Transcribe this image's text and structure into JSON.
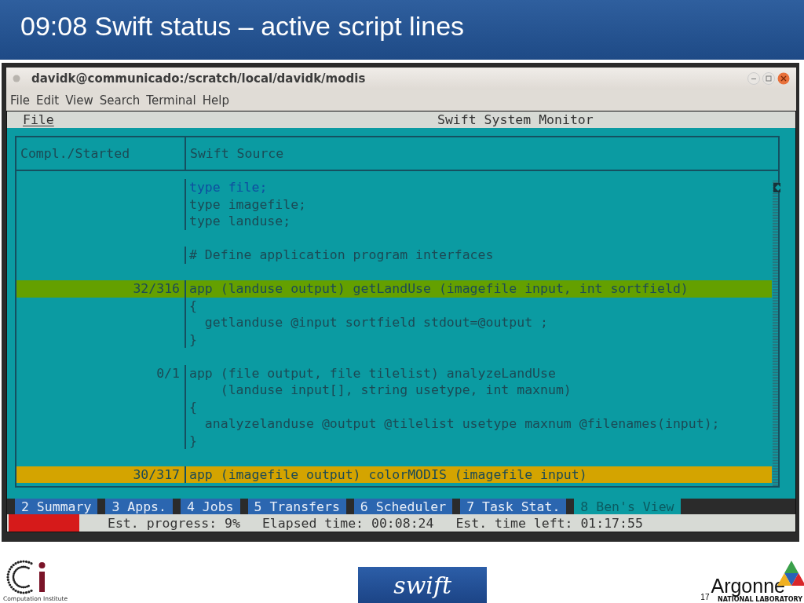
{
  "slide": {
    "title": "09:08 Swift status – active script lines",
    "page_number": "17"
  },
  "window": {
    "title": "davidk@communicado:/scratch/local/davidk/modis",
    "menu": [
      "File",
      "Edit",
      "View",
      "Search",
      "Terminal",
      "Help"
    ]
  },
  "monitor": {
    "menu_item": "File",
    "title": "Swift System Monitor",
    "columns": [
      "Compl./Started",
      "Swift Source"
    ],
    "lines": [
      {
        "kind": "muted",
        "text": "type file;"
      },
      {
        "kind": "code",
        "text": "type imagefile;"
      },
      {
        "kind": "code",
        "text": "type landuse;"
      },
      {
        "kind": "blank"
      },
      {
        "kind": "code",
        "text": "# Define application program interfaces"
      },
      {
        "kind": "blank"
      },
      {
        "kind": "code",
        "count": "32/316",
        "text": "app (landuse output) getLandUse (imagefile input, int sortfield)",
        "color": "#64a000"
      },
      {
        "kind": "code",
        "text": "{"
      },
      {
        "kind": "code",
        "text": "  getlanduse @input sortfield stdout=@output ;"
      },
      {
        "kind": "code",
        "text": "}"
      },
      {
        "kind": "blank"
      },
      {
        "kind": "code",
        "count": "0/1",
        "text": "app (file output, file tilelist) analyzeLandUse"
      },
      {
        "kind": "code",
        "text": "    (landuse input[], string usetype, int maxnum)"
      },
      {
        "kind": "code",
        "text": "{"
      },
      {
        "kind": "code",
        "text": "  analyzelanduse @output @tilelist usetype maxnum @filenames(input);"
      },
      {
        "kind": "code",
        "text": "}"
      },
      {
        "kind": "blank"
      },
      {
        "kind": "code",
        "count": "30/317",
        "text": "app (imagefile output) colorMODIS (imagefile input)",
        "color": "#d4a400"
      }
    ],
    "tabs": [
      {
        "label": "2 Summary",
        "selected": false
      },
      {
        "label": "3 Apps.",
        "selected": false
      },
      {
        "label": "4 Jobs",
        "selected": false
      },
      {
        "label": "5 Transfers",
        "selected": false
      },
      {
        "label": "6 Scheduler",
        "selected": false
      },
      {
        "label": "7 Task Stat.",
        "selected": false
      },
      {
        "label": "8 Ben's View",
        "selected": true
      }
    ],
    "status": {
      "level": 0.09,
      "items": [
        "Est. progress: 9%",
        "Elapsed time: 00:08:24",
        "Est. time left: 01:17:55"
      ]
    }
  },
  "footer": {
    "left_logo_caption": "Computation Institute",
    "center_logo": "swift",
    "right_logo": "Argonne",
    "right_logo_caption": "NATIONAL LABORATORY"
  }
}
